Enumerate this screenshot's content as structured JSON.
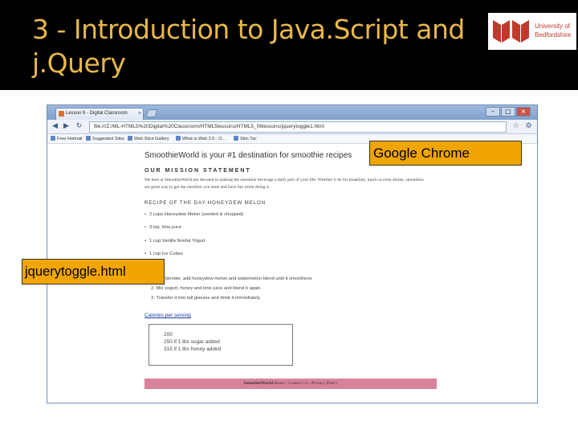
{
  "slide": {
    "title": "3 - Introduction to Java.Script and j.Query"
  },
  "logo": {
    "line1": "University of",
    "line2": "Bedfordshire",
    "brand_color": "#c0392b"
  },
  "browser": {
    "tab_label": "Lesson 6 - Digital Classroom",
    "tab_close": "×",
    "address": "file:///Z:/ML-HTML5%20Digital%20Classroom/HTML5lessons/HTML5_06lessons/jquerytoggle1.html",
    "bookmarks": [
      "Free Hotmail",
      "Suggested Sites",
      "Web Slice Gallery",
      "What is Web 2.0 - O...",
      "Skin Tac"
    ],
    "window_buttons": {
      "min": "–",
      "max": "□",
      "close": "×"
    }
  },
  "page": {
    "headline": "SmoothieWorld is your #1 destination for smoothie recipes",
    "mission_heading": "OUR MISSION STATEMENT",
    "mission_text": "We here at SmoothieWorld are devoted to making the smoothie beverage a daily part of your life. Whether it be for breakfast, lunch or even dinner, smoothies are great way to get the nutrition you need and have fun while doing it.",
    "recipe_heading": "RECIPE OF THE DAY:HONEYDEW MELON",
    "ingredients": [
      "2 cups Honeydew Melon (seeded & chopped)",
      "3 tsp. lime juice",
      "1 cup Vanilla Nonfat Yogurt",
      "1 cup Ice Cubes"
    ],
    "steps": [
      "1. In a blender, add honeydew melon and watermelon blend until it smoothens",
      "2. Mix yogurt, honey and lime juice and blend it again",
      "3. Transfer it into tall glasses and drink it immediately"
    ],
    "calories_link": "Calories per serving",
    "calories": [
      "200",
      "250 if 1 tbs sugar added",
      "315 if 1 tbs honey added"
    ],
    "footer_brand": "SmoothieWorld",
    "footer_links": "Home | Contact Us | Privacy Policy"
  },
  "callouts": {
    "browser_name": "Google Chrome",
    "file_name": "jquerytoggle.html",
    "color": "#f0a500"
  }
}
